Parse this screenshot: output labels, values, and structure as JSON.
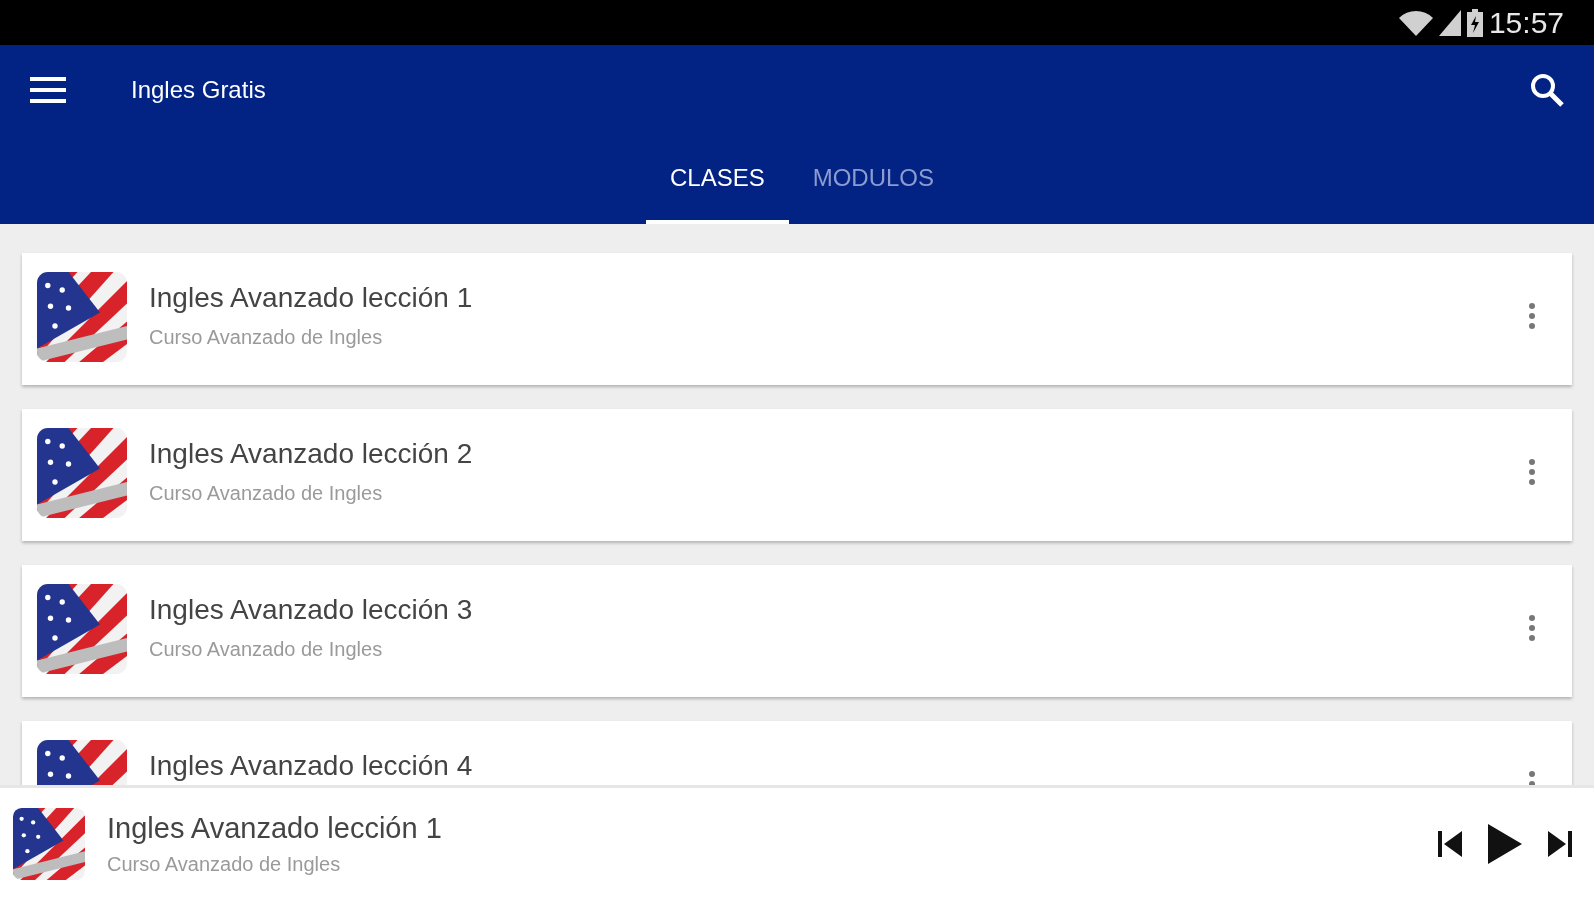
{
  "status_bar": {
    "time": "15:57"
  },
  "app_bar": {
    "title": "Ingles Gratis"
  },
  "tabs": [
    {
      "label": "CLASES",
      "selected": true
    },
    {
      "label": "MODULOS",
      "selected": false
    }
  ],
  "lessons": [
    {
      "title": "Ingles Avanzado lección 1",
      "subtitle": "Curso Avanzado de Ingles"
    },
    {
      "title": "Ingles Avanzado lección 2",
      "subtitle": "Curso Avanzado de Ingles"
    },
    {
      "title": "Ingles Avanzado lección 3",
      "subtitle": "Curso Avanzado de Ingles"
    },
    {
      "title": "Ingles Avanzado lección 4"
    }
  ],
  "player": {
    "title": "Ingles Avanzado lección 1",
    "subtitle": "Curso Avanzado de Ingles"
  }
}
